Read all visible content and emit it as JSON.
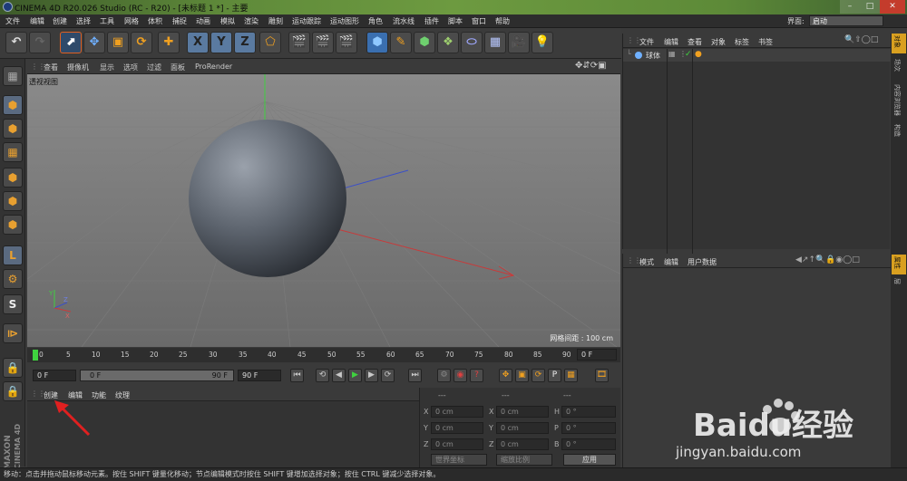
{
  "title": "CINEMA 4D R20.026 Studio (RC - R20) - [未标题 1 *] - 主要",
  "menu": [
    "文件",
    "编辑",
    "创建",
    "选择",
    "工具",
    "网格",
    "体积",
    "捕捉",
    "动画",
    "模拟",
    "渲染",
    "雕刻",
    "运动跟踪",
    "运动图形",
    "角色",
    "流水线",
    "插件",
    "脚本",
    "窗口",
    "帮助"
  ],
  "interface_label": "界面:",
  "interface_value": "启动",
  "viewport_menu": [
    "查看",
    "摄像机",
    "显示",
    "选项",
    "过滤",
    "面板",
    "ProRender"
  ],
  "viewport_name": "透视视图",
  "grid_spacing": "网格间距 : 100 cm",
  "timeline": {
    "ticks": [
      "0",
      "5",
      "10",
      "15",
      "20",
      "25",
      "30",
      "35",
      "40",
      "45",
      "50",
      "55",
      "60",
      "65",
      "70",
      "75",
      "80",
      "85",
      "90"
    ],
    "current_frame": "0 F",
    "start_frame": "0 F",
    "range_start": "0 F",
    "range_end": "90 F",
    "end_frame": "90 F"
  },
  "material_tabs": [
    "创建",
    "编辑",
    "功能",
    "纹理"
  ],
  "coords": {
    "headers": [
      "---",
      "---",
      "---"
    ],
    "rows": [
      {
        "a": "X",
        "av": "0 cm",
        "b": "X",
        "bv": "0 cm",
        "c": "H",
        "cv": "0 °"
      },
      {
        "a": "Y",
        "av": "0 cm",
        "b": "Y",
        "bv": "0 cm",
        "c": "P",
        "cv": "0 °"
      },
      {
        "a": "Z",
        "av": "0 cm",
        "b": "Z",
        "bv": "0 cm",
        "c": "B",
        "cv": "0 °"
      }
    ],
    "world": "世界坐标",
    "scale": "缩放比例",
    "apply": "应用"
  },
  "object_menu": [
    "文件",
    "编辑",
    "查看",
    "对象",
    "标签",
    "书签"
  ],
  "object_item": "球体",
  "attr_menu": [
    "模式",
    "编辑",
    "用户数据"
  ],
  "right_tabs": [
    "对象",
    "场次",
    "内容浏览器",
    "构造"
  ],
  "right_tabs2": [
    "属性",
    "层"
  ],
  "brand": "MAXON CINEMA 4D",
  "status": "移动：点击并拖动鼠标移动元素。按住 SHIFT 键量化移动；节点编辑模式时按住 SHIFT 键增加选择对象；按住 CTRL 键减少选择对象。",
  "watermark": "Baidu经验",
  "watermark_url": "jingyan.baidu.com"
}
